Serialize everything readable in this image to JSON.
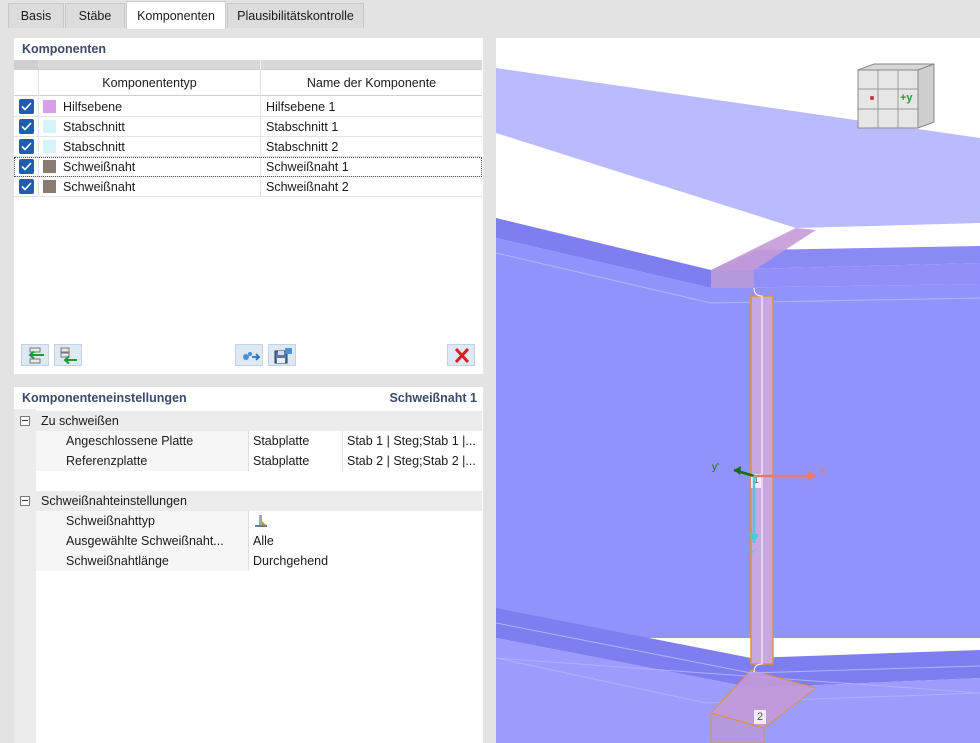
{
  "tabs": [
    "Basis",
    "Stäbe",
    "Komponenten",
    "Plausibilitätskontrolle"
  ],
  "active_tab": "Komponenten",
  "components_panel": {
    "title": "Komponenten",
    "columns": [
      "Komponententyp",
      "Name der Komponente"
    ],
    "rows": [
      {
        "checked": true,
        "color": "#d8a0e8",
        "type": "Hilfsebene",
        "name": "Hilfsebene 1"
      },
      {
        "checked": true,
        "color": "#d4f4f8",
        "type": "Stabschnitt",
        "name": "Stabschnitt 1"
      },
      {
        "checked": true,
        "color": "#d4f4f8",
        "type": "Stabschnitt",
        "name": "Stabschnitt 2"
      },
      {
        "checked": true,
        "color": "#8a7a70",
        "type": "Schweißnaht",
        "name": "Schweißnaht 1"
      },
      {
        "checked": true,
        "color": "#8a7a70",
        "type": "Schweißnaht",
        "name": "Schweißnaht 2"
      }
    ]
  },
  "settings_panel": {
    "title": "Komponenteneinstellungen",
    "selected": "Schweißnaht 1",
    "groups": [
      {
        "label": "Zu schweißen",
        "items": [
          {
            "label": "Angeschlossene Platte",
            "value": "Stabplatte",
            "value2": "Stab 1 | Steg;Stab 1 |..."
          },
          {
            "label": "Referenzplatte",
            "value": "Stabplatte",
            "value2": "Stab 2 | Steg;Stab 2 |..."
          }
        ]
      },
      {
        "label": "Schweißnahteinstellungen",
        "items": [
          {
            "label": "Schweißnahttyp",
            "value": "",
            "icon": "fillet-weld-icon"
          },
          {
            "label": "Ausgewählte Schweißnaht...",
            "value": "Alle"
          },
          {
            "label": "Schweißnahtlänge",
            "value": "Durchgehend"
          }
        ]
      }
    ]
  },
  "viewport": {
    "cube_label": "+y",
    "axes": {
      "y": "y'",
      "x": "x'",
      "z": "z'"
    },
    "weld_labels": [
      "1",
      "2"
    ]
  }
}
